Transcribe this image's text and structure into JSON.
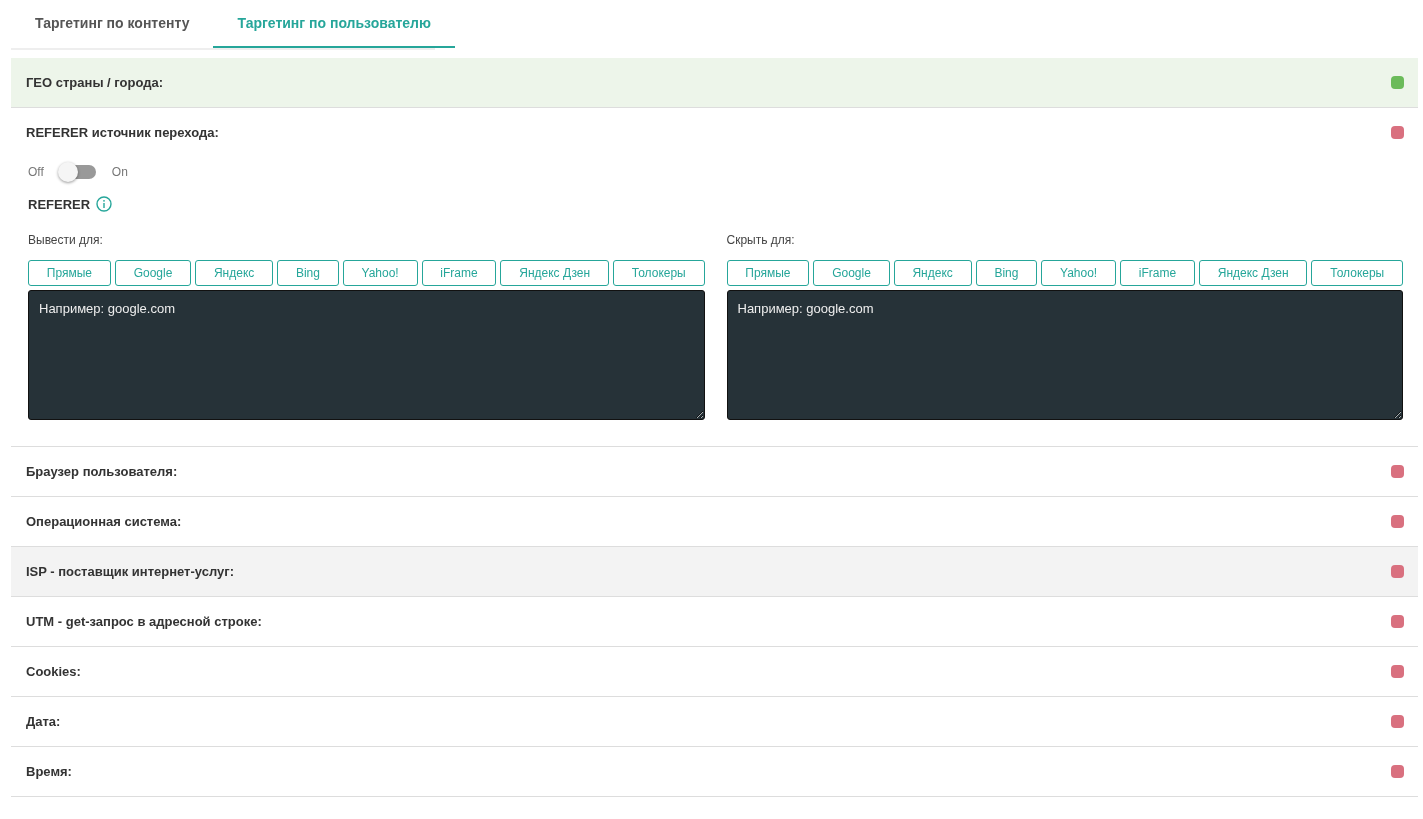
{
  "tabs": [
    {
      "label": "Таргетинг по контенту",
      "selected": false
    },
    {
      "label": "Таргетинг по пользователю",
      "selected": true
    }
  ],
  "sections": [
    {
      "title": "ГЕО страны / города:",
      "enabled": true,
      "hovered": false,
      "expanded": false
    },
    {
      "title": "REFERER источник перехода:",
      "enabled": false,
      "hovered": false,
      "expanded": true,
      "toggle": {
        "off_label": "Off",
        "on_label": "On",
        "on": false
      },
      "field_label": "REFERER",
      "columns": [
        {
          "label": "Вывести для:",
          "buttons": [
            "Прямые",
            "Google",
            "Яндекс",
            "Bing",
            "Yahoo!",
            "iFrame",
            "Яндекс Дзен",
            "Толокеры"
          ],
          "placeholder": "Например: google.com"
        },
        {
          "label": "Скрыть для:",
          "buttons": [
            "Прямые",
            "Google",
            "Яндекс",
            "Bing",
            "Yahoo!",
            "iFrame",
            "Яндекс Дзен",
            "Толокеры"
          ],
          "placeholder": "Например: google.com"
        }
      ]
    },
    {
      "title": "Браузер пользователя:",
      "enabled": false,
      "hovered": false,
      "expanded": false
    },
    {
      "title": "Операционная система:",
      "enabled": false,
      "hovered": false,
      "expanded": false
    },
    {
      "title": "ISP - поставщик интернет-услуг:",
      "enabled": false,
      "hovered": true,
      "expanded": false
    },
    {
      "title": "UTM - get-запрос в адресной строке:",
      "enabled": false,
      "hovered": false,
      "expanded": false
    },
    {
      "title": "Cookies:",
      "enabled": false,
      "hovered": false,
      "expanded": false
    },
    {
      "title": "Дата:",
      "enabled": false,
      "hovered": false,
      "expanded": false
    },
    {
      "title": "Время:",
      "enabled": false,
      "hovered": false,
      "expanded": false
    }
  ]
}
